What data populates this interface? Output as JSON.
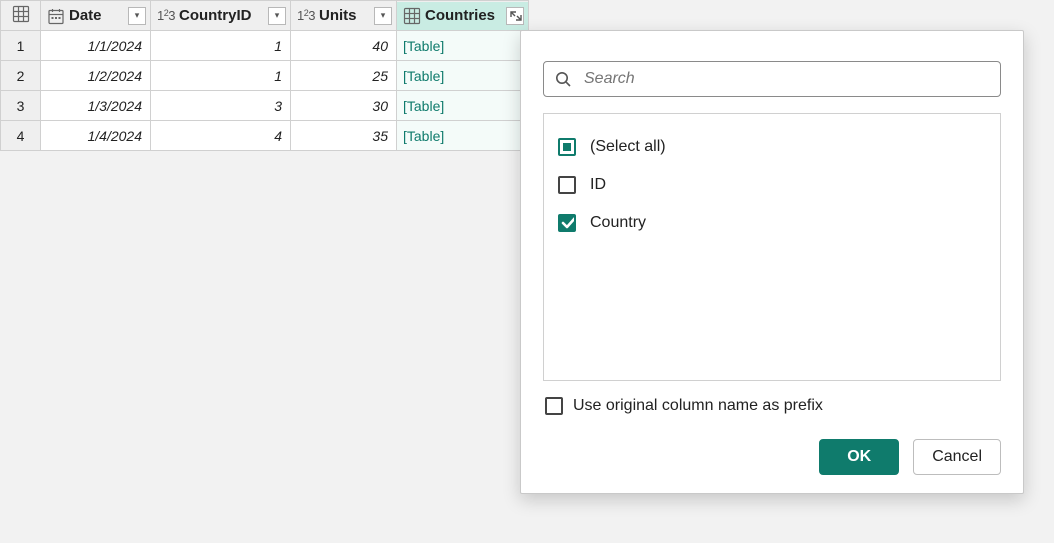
{
  "columns": {
    "date": {
      "label": "Date"
    },
    "cid": {
      "label": "CountryID"
    },
    "units": {
      "label": "Units"
    },
    "countries": {
      "label": "Countries"
    }
  },
  "rows": [
    {
      "n": "1",
      "date": "1/1/2024",
      "cid": "1",
      "units": "40",
      "countries": "[Table]"
    },
    {
      "n": "2",
      "date": "1/2/2024",
      "cid": "1",
      "units": "25",
      "countries": "[Table]"
    },
    {
      "n": "3",
      "date": "1/3/2024",
      "cid": "3",
      "units": "30",
      "countries": "[Table]"
    },
    {
      "n": "4",
      "date": "1/4/2024",
      "cid": "4",
      "units": "35",
      "countries": "[Table]"
    }
  ],
  "popup": {
    "search_placeholder": "Search",
    "options": {
      "all": {
        "label": "(Select all)"
      },
      "id": {
        "label": "ID"
      },
      "country": {
        "label": "Country"
      }
    },
    "prefix": {
      "label": "Use original column name as prefix"
    },
    "ok": {
      "label": "OK"
    },
    "cancel": {
      "label": "Cancel"
    }
  }
}
